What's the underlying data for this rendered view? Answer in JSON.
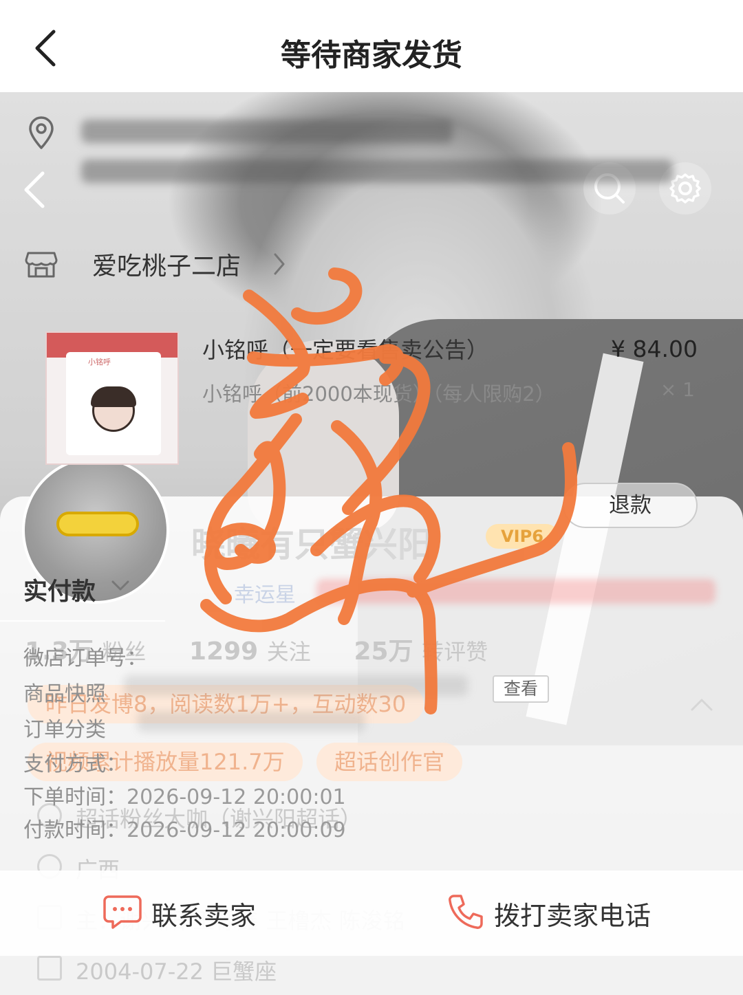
{
  "header": {
    "title": "等待商家发货"
  },
  "shop": {
    "name": "爱吃桃子二店"
  },
  "product": {
    "title": "小铭呼（一定要看售卖公告）",
    "price": "¥ 84.00",
    "spec": "小铭呼（前2000本现货）（每人限购2）",
    "quantity": "× 1",
    "thumb_tag": "小铭呼"
  },
  "actions": {
    "refund_label": "退款"
  },
  "payment": {
    "section_label": "实付款"
  },
  "order_details": {
    "order_no_label": "微店订单号：",
    "snapshot_label": "商品快照",
    "view_label": "查看",
    "category_label": "订单分类",
    "pay_method_label": "支付方式：",
    "order_time_label": "下单时间：",
    "order_time_value": "2026-09-12 20:00:01",
    "pay_time_label": "付款时间：",
    "pay_time_value": "2026-09-12 20:00:09"
  },
  "bottom_bar": {
    "contact_seller": "联系卖家",
    "call_seller": "拨打卖家电话"
  },
  "background_profile": {
    "nickname": "晓曦有只蟹兴阳",
    "vip": "VIP6",
    "lucky_star": "幸运星",
    "stats": {
      "followers_count": "1.3万",
      "followers_label": "粉丝",
      "following_count": "1299",
      "following_label": "关注",
      "likes_count": "25万",
      "likes_label": "转评赞"
    },
    "yesterday_info": "昨日发博8，阅读数1万+，互动数30",
    "video_plays": "视频累计播放量121.7万",
    "creator_tag": "超话创作官",
    "fan_tag": "超话粉丝大咖（谢兴阳超话）",
    "ip_location": "广西",
    "related": "主：谢兴阳 王栎鑫 王橹杰 陈浚铭",
    "birthday": "2004-07-22 巨蟹座"
  },
  "colors": {
    "accent": "#f07c3c",
    "scribble": "#f27a3d",
    "vip_gold": "#e6a23c"
  }
}
